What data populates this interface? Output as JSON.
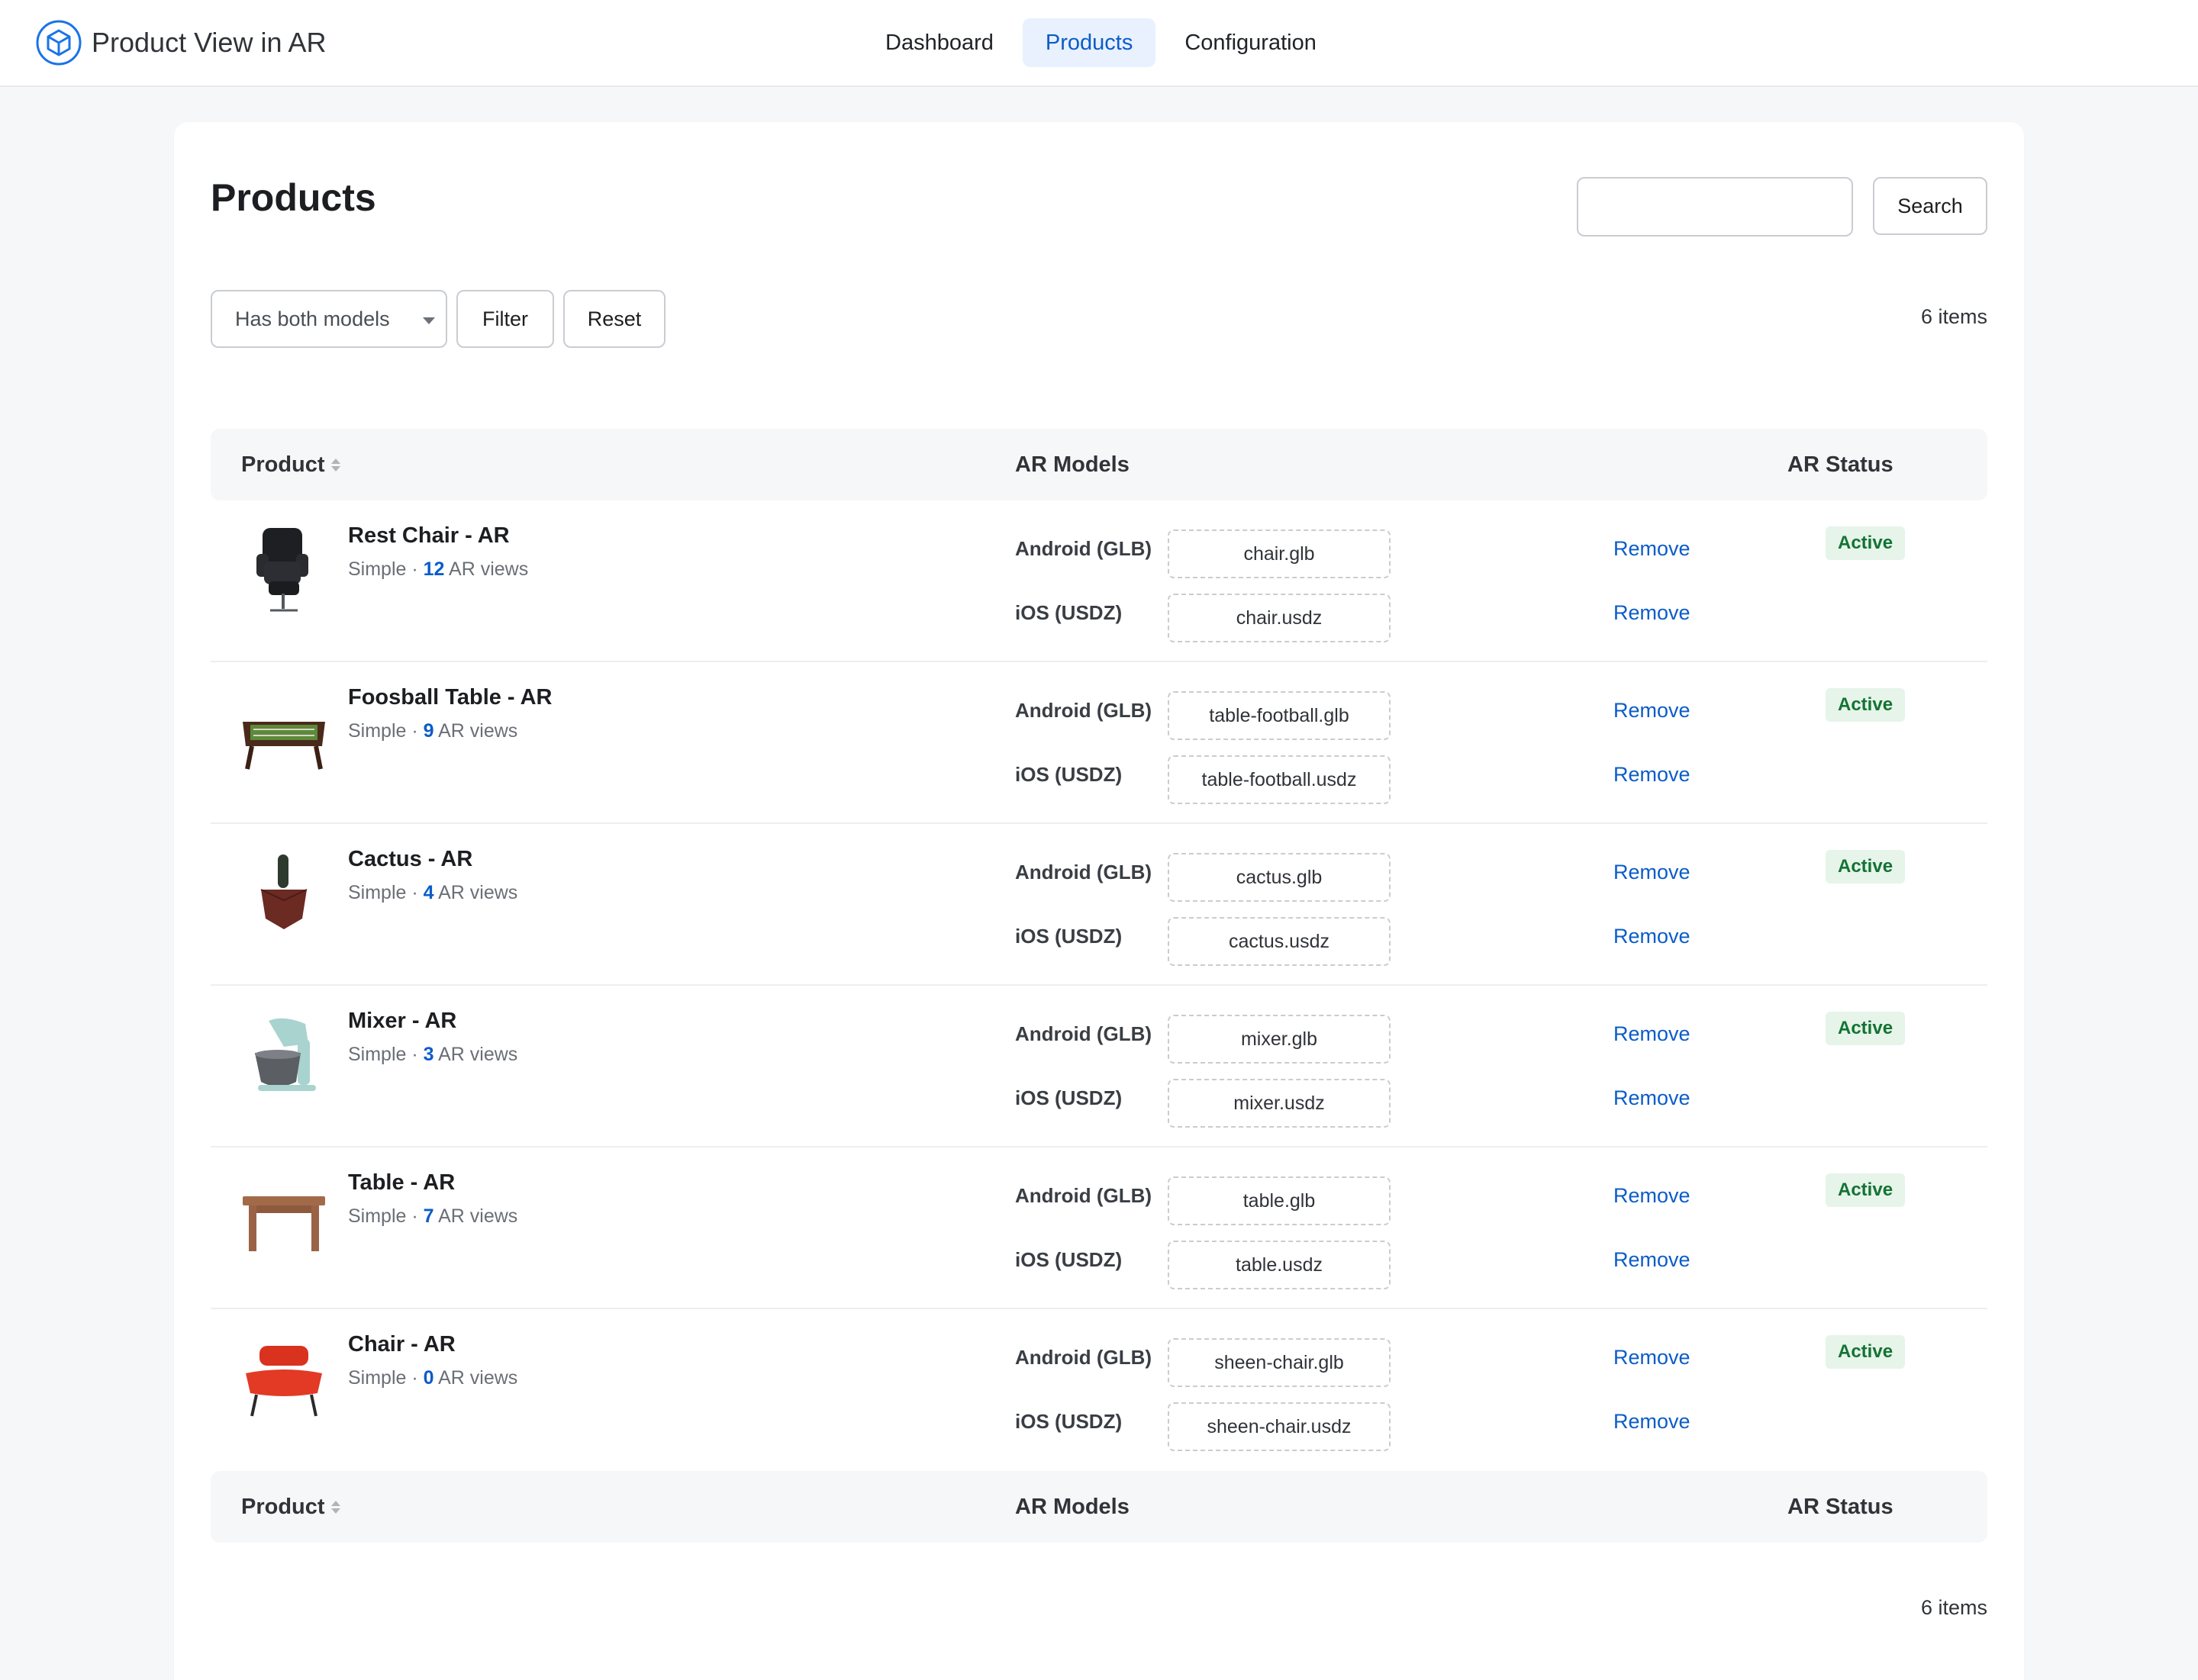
{
  "app": {
    "title": "Product View in AR",
    "nav": [
      {
        "label": "Dashboard",
        "active": false
      },
      {
        "label": "Products",
        "active": true
      },
      {
        "label": "Configuration",
        "active": false
      }
    ]
  },
  "page": {
    "title": "Products",
    "search": {
      "value": "",
      "placeholder": "",
      "button_label": "Search"
    },
    "filter": {
      "selected": "Has both models",
      "filter_label": "Filter",
      "reset_label": "Reset"
    },
    "count_label": "6 items"
  },
  "table": {
    "columns": {
      "product": "Product",
      "models": "AR Models",
      "status": "AR Status"
    },
    "model_labels": {
      "android": "Android (GLB)",
      "ios": "iOS (USDZ)"
    },
    "remove_label": "Remove",
    "views_suffix": "AR views",
    "rows": [
      {
        "name": "Rest Chair - AR",
        "type": "Simple",
        "views": "12",
        "android": "chair.glb",
        "ios": "chair.usdz",
        "status": "Active",
        "thumb_icon": "rest-chair-thumbnail"
      },
      {
        "name": "Foosball Table - AR",
        "type": "Simple",
        "views": "9",
        "android": "table-football.glb",
        "ios": "table-football.usdz",
        "status": "Active",
        "thumb_icon": "foosball-table-thumbnail"
      },
      {
        "name": "Cactus - AR",
        "type": "Simple",
        "views": "4",
        "android": "cactus.glb",
        "ios": "cactus.usdz",
        "status": "Active",
        "thumb_icon": "cactus-thumbnail"
      },
      {
        "name": "Mixer - AR",
        "type": "Simple",
        "views": "3",
        "android": "mixer.glb",
        "ios": "mixer.usdz",
        "status": "Active",
        "thumb_icon": "mixer-thumbnail"
      },
      {
        "name": "Table - AR",
        "type": "Simple",
        "views": "7",
        "android": "table.glb",
        "ios": "table.usdz",
        "status": "Active",
        "thumb_icon": "table-thumbnail"
      },
      {
        "name": "Chair - AR",
        "type": "Simple",
        "views": "0",
        "android": "sheen-chair.glb",
        "ios": "sheen-chair.usdz",
        "status": "Active",
        "thumb_icon": "red-chair-thumbnail"
      }
    ]
  },
  "colors": {
    "accent": "#0b5cc9",
    "active_badge_bg": "#e6f4ea",
    "active_badge_text": "#137333"
  }
}
